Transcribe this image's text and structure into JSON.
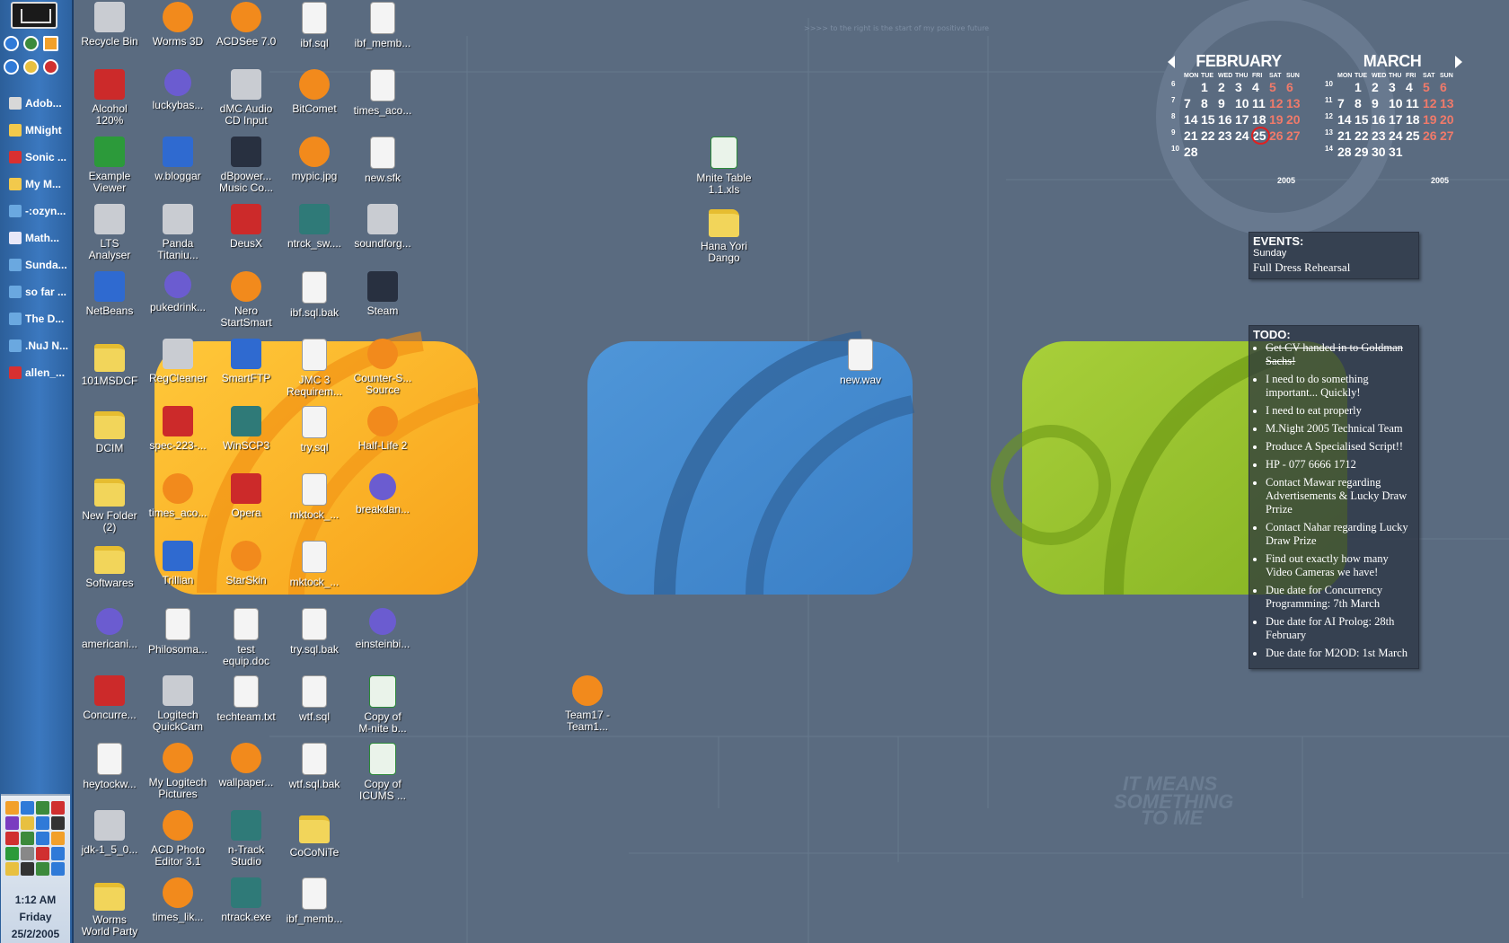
{
  "taskbar": {
    "tasks": [
      {
        "label": "Adob...",
        "color": "#d8d8d8"
      },
      {
        "label": "MNight",
        "color": "#f2c94c"
      },
      {
        "label": "Sonic ...",
        "color": "#d83030"
      },
      {
        "label": "My M...",
        "color": "#f2c94c"
      },
      {
        "label": "-:ozyn...",
        "color": "#6aa8e0"
      },
      {
        "label": "Math...",
        "color": "#e8e8f8"
      },
      {
        "label": "Sunda...",
        "color": "#6aa8e0"
      },
      {
        "label": "so far ...",
        "color": "#6aa8e0"
      },
      {
        "label": "The D...",
        "color": "#6aa8e0"
      },
      {
        "label": ".NuJ N...",
        "color": "#6aa8e0"
      },
      {
        "label": "allen_...",
        "color": "#d83030"
      }
    ],
    "clock": {
      "time": "1:12 AM",
      "day": "Friday",
      "date": "25/2/2005"
    }
  },
  "desktop": {
    "icons": [
      [
        "Recycle Bin",
        "Worms 3D",
        "ACDSee 7.0",
        "ibf.sql",
        "ibf_memb..."
      ],
      [
        "Alcohol\n120%",
        "luckybas...",
        "dMC Audio\nCD Input",
        "BitComet",
        "times_aco..."
      ],
      [
        "Example\nViewer",
        "w.bloggar",
        "dBpower...\nMusic Co...",
        "mypic.jpg",
        "new.sfk"
      ],
      [
        "LTS\nAnalyser",
        "Panda\nTitaniu...",
        "DeusX",
        "ntrck_sw....",
        "soundforg..."
      ],
      [
        "NetBeans",
        "pukedrink...",
        "Nero\nStartSmart",
        "ibf.sql.bak",
        "Steam"
      ],
      [
        "101MSDCF",
        "RegCleaner",
        "SmartFTP",
        "JMC 3\nRequirem...",
        "Counter-S...\nSource"
      ],
      [
        "DCIM",
        "spec-223-...",
        "WinSCP3",
        "try.sql",
        "Half-Life 2"
      ],
      [
        "New Folder\n(2)",
        "times_aco...",
        "Opera",
        "mktock_...",
        "breakdan..."
      ],
      [
        "Softwares",
        "Trillian",
        "StarSkin",
        "mktock_...",
        ""
      ],
      [
        "americani...",
        "Philosoma...",
        "test\nequip.doc",
        "try.sql.bak",
        "einsteinbi..."
      ],
      [
        "Concurre...",
        "Logitech\nQuickCam",
        "techteam.txt",
        "wtf.sql",
        "Copy of\nM-nite b..."
      ],
      [
        "heytockw...",
        "My Logitech\nPictures",
        "wallpaper...",
        "wtf.sql.bak",
        "Copy of\nICUMS ..."
      ],
      [
        "jdk-1_5_0...",
        "ACD Photo\nEditor 3.1",
        "n-Track\nStudio",
        "CoCoNiTe",
        ""
      ],
      [
        "Worms\nWorld Party",
        "times_lik...",
        "ntrack.exe",
        "ibf_memb...",
        ""
      ]
    ],
    "loose_icons": [
      {
        "label": "Mnite Table\n1.1.xls",
        "kind": "xls"
      },
      {
        "label": "Hana Yori\nDango",
        "kind": "folder"
      },
      {
        "label": "new.wav",
        "kind": "doc"
      },
      {
        "label": "Team17 -\nTeam1...",
        "kind": "orange"
      }
    ]
  },
  "calendar": [
    {
      "month": "FEBRUARY",
      "year": "2005",
      "weekdays": [
        "MON",
        "TUE",
        "WED",
        "THU",
        "FRI",
        "SAT",
        "SUN"
      ],
      "weeks": [
        {
          "wk": "6",
          "days": [
            "",
            "1",
            "2",
            "3",
            "4",
            "5",
            "6"
          ]
        },
        {
          "wk": "7",
          "days": [
            "7",
            "8",
            "9",
            "10",
            "11",
            "12",
            "13"
          ]
        },
        {
          "wk": "8",
          "days": [
            "14",
            "15",
            "16",
            "17",
            "18",
            "19",
            "20"
          ]
        },
        {
          "wk": "9",
          "days": [
            "21",
            "22",
            "23",
            "24",
            "25",
            "26",
            "27"
          ]
        },
        {
          "wk": "10",
          "days": [
            "28",
            "",
            "",
            "",
            "",
            "",
            ""
          ]
        }
      ],
      "today": "25"
    },
    {
      "month": "MARCH",
      "year": "2005",
      "weekdays": [
        "MON",
        "TUE",
        "WED",
        "THU",
        "FRI",
        "SAT",
        "SUN"
      ],
      "weeks": [
        {
          "wk": "10",
          "days": [
            "",
            "1",
            "2",
            "3",
            "4",
            "5",
            "6"
          ]
        },
        {
          "wk": "11",
          "days": [
            "7",
            "8",
            "9",
            "10",
            "11",
            "12",
            "13"
          ]
        },
        {
          "wk": "12",
          "days": [
            "14",
            "15",
            "16",
            "17",
            "18",
            "19",
            "20"
          ]
        },
        {
          "wk": "13",
          "days": [
            "21",
            "22",
            "23",
            "24",
            "25",
            "26",
            "27"
          ]
        },
        {
          "wk": "14",
          "days": [
            "28",
            "29",
            "30",
            "31",
            "",
            "",
            ""
          ]
        }
      ],
      "today": ""
    }
  ],
  "events": {
    "header": "EVENTS:",
    "day": "Sunday",
    "text": "Full Dress Rehearsal"
  },
  "todo": {
    "header": "TODO:",
    "items": [
      {
        "text": "Get CV handed in to Goldman Sachs!",
        "done": true
      },
      {
        "text": "I need to do something important... Quickly!",
        "done": false
      },
      {
        "text": "I need to eat properly",
        "done": false
      },
      {
        "text": "M.Night 2005 Technical Team",
        "done": false
      },
      {
        "text": "Produce A Specialised Script!!",
        "done": false
      },
      {
        "text": "HP - 077 6666 1712",
        "done": false
      },
      {
        "text": "Contact Mawar regarding Advertisements & Lucky Draw Prrize",
        "done": false
      },
      {
        "text": "Contact Nahar regarding Lucky Draw Prize",
        "done": false
      },
      {
        "text": "Find out exactly how many Video Cameras we have!",
        "done": false
      },
      {
        "text": "Due date for Concurrency Programming: 7th March",
        "done": false
      },
      {
        "text": "Due date for AI Prolog: 28th February",
        "done": false
      },
      {
        "text": "Due date for M2OD: 1st March",
        "done": false
      }
    ]
  },
  "wallpaper": {
    "tagline": ">>>> to the right is the start of my positive future",
    "slogan_1": "IT MEANS",
    "slogan_2": "SOMETHING",
    "slogan_3": "TO ME"
  }
}
